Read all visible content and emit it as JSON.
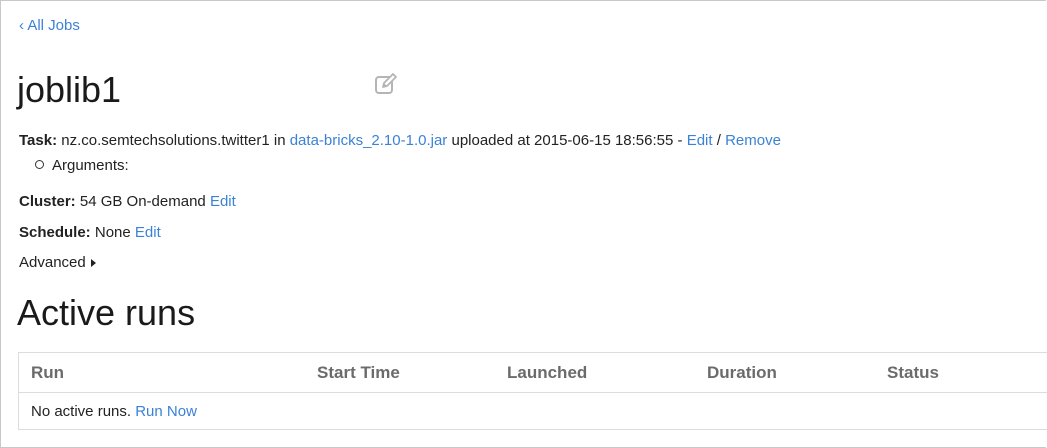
{
  "nav": {
    "back_label": "‹ All Jobs"
  },
  "job": {
    "title": "joblib1",
    "edit_icon": "pencil-square-icon"
  },
  "task": {
    "label": "Task:",
    "class_name": "nz.co.semtechsolutions.twitter1",
    "in_word": "in",
    "jar_link": "data-bricks_2.10-1.0.jar",
    "uploaded_text": "uploaded at 2015-06-15 18:56:55 -",
    "edit_label": "Edit",
    "separator": "/",
    "remove_label": "Remove"
  },
  "arguments": {
    "label": "Arguments:"
  },
  "cluster": {
    "label": "Cluster:",
    "value": "54 GB On-demand",
    "edit_label": "Edit"
  },
  "schedule": {
    "label": "Schedule:",
    "value": "None",
    "edit_label": "Edit"
  },
  "advanced": {
    "label": "Advanced"
  },
  "active_runs": {
    "heading": "Active runs",
    "columns": [
      "Run",
      "Start Time",
      "Launched",
      "Duration",
      "Status"
    ],
    "empty_text": "No active runs.",
    "run_now_label": "Run Now"
  },
  "colors": {
    "link": "#3b82d6",
    "header_text": "#6b6b6b",
    "border": "#dcdcdc"
  }
}
